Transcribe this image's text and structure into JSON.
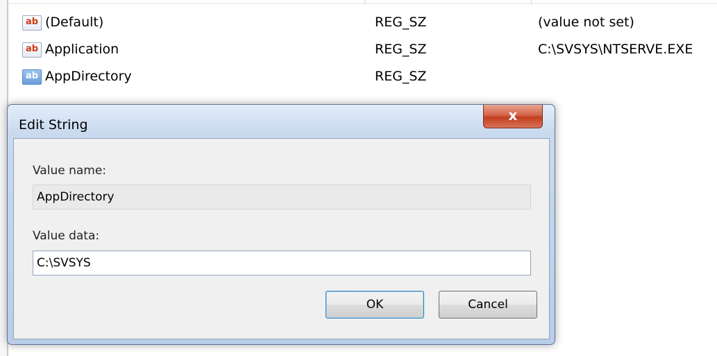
{
  "registry": {
    "values": [
      {
        "name": "(Default)",
        "type": "REG_SZ",
        "data": "(value not set)",
        "icon": "string-value-icon"
      },
      {
        "name": "Application",
        "type": "REG_SZ",
        "data": "C:\\SVSYS\\NTSERVE.EXE",
        "icon": "string-value-icon"
      },
      {
        "name": "AppDirectory",
        "type": "REG_SZ",
        "data": "",
        "icon": "string-value-icon"
      }
    ]
  },
  "dialog": {
    "title": "Edit String",
    "close_glyph": "x",
    "value_name_label": "Value name:",
    "value_name": "AppDirectory",
    "value_data_label": "Value data:",
    "value_data": "C:\\SVSYS",
    "ok_label": "OK",
    "cancel_label": "Cancel"
  },
  "colors": {
    "close_button": "#c3401f",
    "selected_icon": "#6b9fdc",
    "dialog_frame": "#c9daef"
  }
}
